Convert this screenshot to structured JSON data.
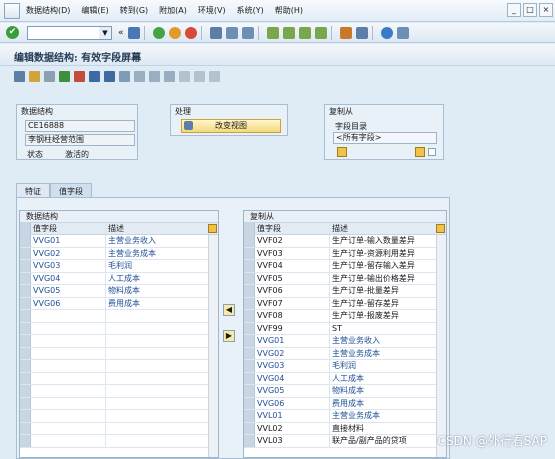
{
  "menu": [
    "数据结构(D)",
    "编辑(E)",
    "转到(G)",
    "附加(A)",
    "环境(V)",
    "系统(Y)",
    "帮助(H)"
  ],
  "title": "编辑数据结构: 有效字段屏幕",
  "data_structure_group": {
    "title": "数据结构",
    "code": "CE16888",
    "desc": "李钢柱经营范围",
    "status_label": "状态",
    "status_value": "激活的"
  },
  "process_group": {
    "title": "处理",
    "button": "改变视图"
  },
  "copy_from_group": {
    "title": "复制从",
    "catalog_label": "字段目录",
    "catalog_value": "<所有字段>"
  },
  "tabs": [
    "特证",
    "值字段"
  ],
  "left_table": {
    "title": "数据结构",
    "col1": "值字段",
    "col2": "描述",
    "rows": [
      [
        "VVG01",
        "主营业务收入"
      ],
      [
        "VVG02",
        "主营业务成本"
      ],
      [
        "VVG03",
        "毛利润"
      ],
      [
        "VVG04",
        "人工成本"
      ],
      [
        "VVG05",
        "物料成本"
      ],
      [
        "VVG06",
        "费用成本"
      ]
    ]
  },
  "right_table": {
    "title": "复制从",
    "col1": "值字段",
    "col2": "描述",
    "rows": [
      [
        "VVF02",
        "生产订单-输入数量差异"
      ],
      [
        "VVF03",
        "生产订单-资源利用差异"
      ],
      [
        "VVF04",
        "生产订单-留存输入差异"
      ],
      [
        "VVF05",
        "生产订单-输出价格差异"
      ],
      [
        "VVF06",
        "生产订单-批量差异"
      ],
      [
        "VVF07",
        "生产订单-留存差异"
      ],
      [
        "VVF08",
        "生产订单-报废差异"
      ],
      [
        "VVF99",
        "ST"
      ],
      [
        "VVG01",
        "主营业务收入"
      ],
      [
        "VVG02",
        "主营业务成本"
      ],
      [
        "VVG03",
        "毛利润"
      ],
      [
        "VVG04",
        "人工成本"
      ],
      [
        "VVG05",
        "物料成本"
      ],
      [
        "VVG06",
        "费用成本"
      ],
      [
        "VVL01",
        "主营业务成本"
      ],
      [
        "VVL02",
        "直接材料"
      ],
      [
        "VVL03",
        "联产品/副产品的贷项"
      ]
    ]
  },
  "watermark": "CSDN @外行看SAP"
}
